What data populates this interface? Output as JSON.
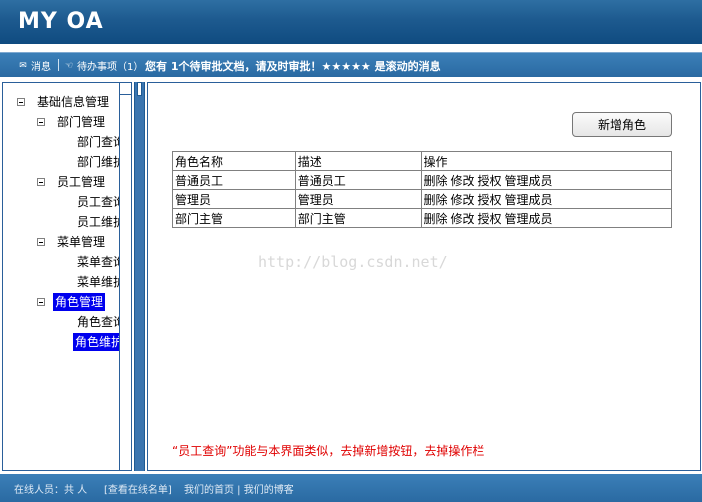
{
  "header": {
    "logo": "MY OA"
  },
  "msgbar": {
    "message_label": "消息",
    "todo_label": "待办事项（1）",
    "scroll_text": "您有 1个待审批文档，请及时审批！★★★★★ 是滚动的消息"
  },
  "tree": {
    "root": "基础信息管理",
    "groups": [
      {
        "label": "部门管理",
        "children": [
          "部门查询",
          "部门维护"
        ]
      },
      {
        "label": "员工管理",
        "children": [
          "员工查询",
          "员工维护"
        ]
      },
      {
        "label": "菜单管理",
        "children": [
          "菜单查询",
          "菜单维护"
        ]
      },
      {
        "label": "角色管理",
        "children": [
          "角色查询",
          "角色维护"
        ]
      }
    ]
  },
  "main": {
    "add_button": "新增角色",
    "table": {
      "headers": [
        "角色名称",
        "描述",
        "操作"
      ],
      "rows": [
        {
          "name": "普通员工",
          "desc": "普通员工"
        },
        {
          "name": "管理员",
          "desc": "管理员"
        },
        {
          "name": "部门主管",
          "desc": "部门主管"
        }
      ],
      "ops": [
        "删除",
        "修改",
        "授权",
        "管理成员"
      ]
    },
    "watermark": "http://blog.csdn.net/",
    "note": "“员工查询”功能与本界面类似，去掉新增按钮，去掉操作栏"
  },
  "footer": {
    "online": "在线人员：共 人",
    "view_online": "[查看在线名单]",
    "links": "我们的首页 | 我们的博客"
  },
  "colors": {
    "header": "#1d5a8f",
    "selected": "#0000ee",
    "note": "#e00000"
  }
}
